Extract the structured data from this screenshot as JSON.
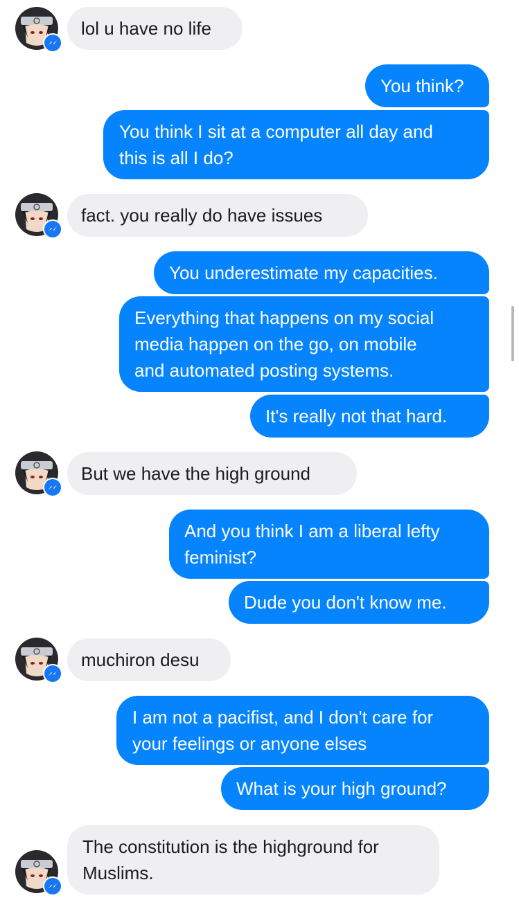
{
  "messages": [
    {
      "from": "other",
      "text": "lol u have no life"
    },
    {
      "from": "me",
      "text": "You think?"
    },
    {
      "from": "me",
      "text": "You think I sit at a computer all day and\nthis is all I do?"
    },
    {
      "from": "other",
      "text": "fact. you really do have issues"
    },
    {
      "from": "me",
      "text": "You underestimate my capacities."
    },
    {
      "from": "me",
      "text": "Everything that happens on my social\nmedia happen on the go, on mobile\nand automated posting systems."
    },
    {
      "from": "me",
      "text": "It's really not that hard."
    },
    {
      "from": "other",
      "text": "But we have the high ground"
    },
    {
      "from": "me",
      "text": "And you think I am a liberal lefty\nfeminist?"
    },
    {
      "from": "me",
      "text": "Dude you don't know me."
    },
    {
      "from": "other",
      "text": "muchiron desu"
    },
    {
      "from": "me",
      "text": "I am not a pacifist, and I don't care for\nyour feelings or anyone elses"
    },
    {
      "from": "me",
      "text": "What is your high ground?"
    },
    {
      "from": "other",
      "text": "The constitution is the highground for\nMuslims."
    }
  ],
  "colors": {
    "outgoing": "#0584fe",
    "incoming": "#efeff1",
    "badge": "#1877f2"
  },
  "icons": {
    "avatar": "ninja-headband-avatar",
    "badge": "messenger-badge-icon"
  }
}
